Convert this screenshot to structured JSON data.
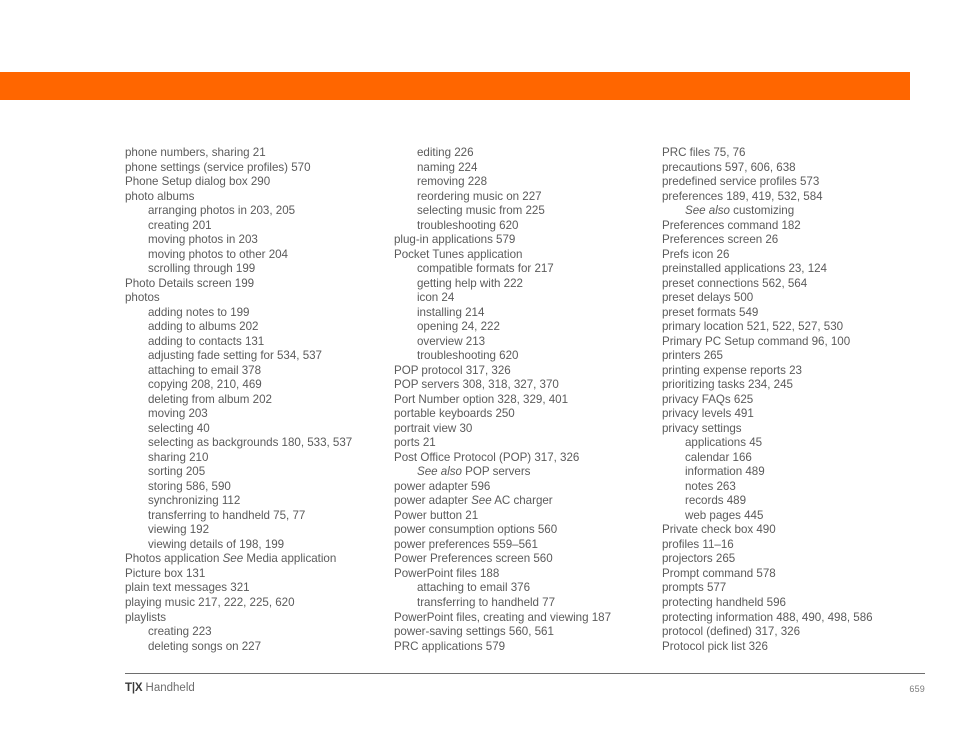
{
  "header": {
    "band_color": "#ff6600"
  },
  "footer": {
    "brand": "T|X",
    "product": "Handheld",
    "page_number": "659"
  },
  "index": {
    "columns": [
      {
        "name": "column-1",
        "entries": [
          {
            "level": 1,
            "text": "phone numbers, sharing 21"
          },
          {
            "level": 1,
            "text": "phone settings (service profiles) 570"
          },
          {
            "level": 1,
            "text": "Phone Setup dialog box 290"
          },
          {
            "level": 1,
            "text": "photo albums"
          },
          {
            "level": 2,
            "text": "arranging photos in 203, 205"
          },
          {
            "level": 2,
            "text": "creating 201"
          },
          {
            "level": 2,
            "text": "moving photos in 203"
          },
          {
            "level": 2,
            "text": "moving photos to other 204"
          },
          {
            "level": 2,
            "text": "scrolling through 199"
          },
          {
            "level": 1,
            "text": "Photo Details screen 199"
          },
          {
            "level": 1,
            "text": "photos"
          },
          {
            "level": 2,
            "text": "adding notes to 199"
          },
          {
            "level": 2,
            "text": "adding to albums 202"
          },
          {
            "level": 2,
            "text": "adding to contacts 131"
          },
          {
            "level": 2,
            "text": "adjusting fade setting for 534, 537"
          },
          {
            "level": 2,
            "text": "attaching to email 378"
          },
          {
            "level": 2,
            "text": "copying 208, 210, 469"
          },
          {
            "level": 2,
            "text": "deleting from album 202"
          },
          {
            "level": 2,
            "text": "moving 203"
          },
          {
            "level": 2,
            "text": "selecting 40"
          },
          {
            "level": 2,
            "text": "selecting as backgrounds 180, 533, 537"
          },
          {
            "level": 2,
            "text": "sharing 210"
          },
          {
            "level": 2,
            "text": "sorting 205"
          },
          {
            "level": 2,
            "text": "storing 586, 590"
          },
          {
            "level": 2,
            "text": "synchronizing 112"
          },
          {
            "level": 2,
            "text": "transferring to handheld 75, 77"
          },
          {
            "level": 2,
            "text": "viewing 192"
          },
          {
            "level": 2,
            "text": "viewing details of 198, 199"
          },
          {
            "level": 1,
            "text": "Photos application ",
            "italic": "See",
            "text_after": " Media application"
          },
          {
            "level": 1,
            "text": "Picture box 131"
          },
          {
            "level": 1,
            "text": "plain text messages 321"
          },
          {
            "level": 1,
            "text": "playing music 217, 222, 225, 620"
          },
          {
            "level": 1,
            "text": "playlists"
          },
          {
            "level": 2,
            "text": "creating 223"
          },
          {
            "level": 2,
            "text": "deleting songs on 227"
          }
        ]
      },
      {
        "name": "column-2",
        "entries": [
          {
            "level": 2,
            "text": "editing 226"
          },
          {
            "level": 2,
            "text": "naming 224"
          },
          {
            "level": 2,
            "text": "removing 228"
          },
          {
            "level": 2,
            "text": "reordering music on 227"
          },
          {
            "level": 2,
            "text": "selecting music from 225"
          },
          {
            "level": 2,
            "text": "troubleshooting 620"
          },
          {
            "level": 1,
            "text": "plug-in applications 579"
          },
          {
            "level": 1,
            "text": "Pocket Tunes application"
          },
          {
            "level": 2,
            "text": "compatible formats for 217"
          },
          {
            "level": 2,
            "text": "getting help with 222"
          },
          {
            "level": 2,
            "text": "icon 24"
          },
          {
            "level": 2,
            "text": "installing 214"
          },
          {
            "level": 2,
            "text": "opening 24, 222"
          },
          {
            "level": 2,
            "text": "overview 213"
          },
          {
            "level": 2,
            "text": "troubleshooting 620"
          },
          {
            "level": 1,
            "text": "POP protocol 317, 326"
          },
          {
            "level": 1,
            "text": "POP servers 308, 318, 327, 370"
          },
          {
            "level": 1,
            "text": "Port Number option 328, 329, 401"
          },
          {
            "level": 1,
            "text": "portable keyboards 250"
          },
          {
            "level": 1,
            "text": "portrait view 30"
          },
          {
            "level": 1,
            "text": "ports 21"
          },
          {
            "level": 1,
            "text": "Post Office Protocol (POP) 317, 326"
          },
          {
            "level": 2,
            "text": "",
            "italic": "See also",
            "text_after": " POP servers"
          },
          {
            "level": 1,
            "text": "power adapter 596"
          },
          {
            "level": 1,
            "text": "power adapter ",
            "italic": "See",
            "text_after": " AC charger"
          },
          {
            "level": 1,
            "text": "Power button 21"
          },
          {
            "level": 1,
            "text": "power consumption options 560"
          },
          {
            "level": 1,
            "text": "power preferences 559–561"
          },
          {
            "level": 1,
            "text": "Power Preferences screen 560"
          },
          {
            "level": 1,
            "text": "PowerPoint files 188"
          },
          {
            "level": 2,
            "text": "attaching to email 376"
          },
          {
            "level": 2,
            "text": "transferring to handheld 77"
          },
          {
            "level": 1,
            "text": "PowerPoint files, creating and viewing 187"
          },
          {
            "level": 1,
            "text": "power-saving settings 560, 561"
          },
          {
            "level": 1,
            "text": "PRC applications 579"
          }
        ]
      },
      {
        "name": "column-3",
        "entries": [
          {
            "level": 1,
            "text": "PRC files 75, 76"
          },
          {
            "level": 1,
            "text": "precautions 597, 606, 638"
          },
          {
            "level": 1,
            "text": "predefined service profiles 573"
          },
          {
            "level": 1,
            "text": "preferences 189, 419, 532, 584"
          },
          {
            "level": 2,
            "text": "",
            "italic": "See also",
            "text_after": " customizing"
          },
          {
            "level": 1,
            "text": "Preferences command 182"
          },
          {
            "level": 1,
            "text": "Preferences screen 26"
          },
          {
            "level": 1,
            "text": "Prefs icon 26"
          },
          {
            "level": 1,
            "text": "preinstalled applications 23, 124"
          },
          {
            "level": 1,
            "text": "preset connections 562, 564"
          },
          {
            "level": 1,
            "text": "preset delays 500"
          },
          {
            "level": 1,
            "text": "preset formats 549"
          },
          {
            "level": 1,
            "text": "primary location 521, 522, 527, 530"
          },
          {
            "level": 1,
            "text": "Primary PC Setup command 96, 100"
          },
          {
            "level": 1,
            "text": "printers 265"
          },
          {
            "level": 1,
            "text": "printing expense reports 23"
          },
          {
            "level": 1,
            "text": "prioritizing tasks 234, 245"
          },
          {
            "level": 1,
            "text": "privacy FAQs 625"
          },
          {
            "level": 1,
            "text": "privacy levels 491"
          },
          {
            "level": 1,
            "text": "privacy settings"
          },
          {
            "level": 2,
            "text": "applications 45"
          },
          {
            "level": 2,
            "text": "calendar 166"
          },
          {
            "level": 2,
            "text": "information 489"
          },
          {
            "level": 2,
            "text": "notes 263"
          },
          {
            "level": 2,
            "text": "records 489"
          },
          {
            "level": 2,
            "text": "web pages 445"
          },
          {
            "level": 1,
            "text": "Private check box 490"
          },
          {
            "level": 1,
            "text": "profiles 11–16"
          },
          {
            "level": 1,
            "text": "projectors 265"
          },
          {
            "level": 1,
            "text": "Prompt command 578"
          },
          {
            "level": 1,
            "text": "prompts 577"
          },
          {
            "level": 1,
            "text": "protecting handheld 596"
          },
          {
            "level": 1,
            "text": "protecting information 488, 490, 498, 586"
          },
          {
            "level": 1,
            "text": "protocol (defined) 317, 326"
          },
          {
            "level": 1,
            "text": "Protocol pick list 326"
          }
        ]
      }
    ]
  }
}
